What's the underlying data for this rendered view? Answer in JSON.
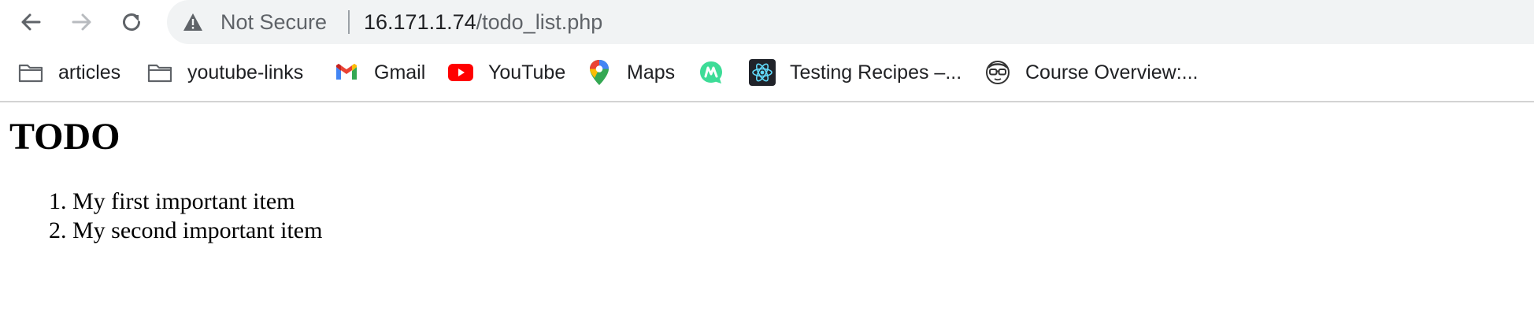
{
  "browser": {
    "security_label": "Not Secure",
    "url_host": "16.171.1.74",
    "url_path": "/todo_list.php",
    "accent": "#f1f3f4"
  },
  "bookmarks": [
    {
      "label": "articles",
      "icon": "folder-icon"
    },
    {
      "label": "youtube-links",
      "icon": "folder-icon"
    },
    {
      "label": "Gmail",
      "icon": "gmail-icon"
    },
    {
      "label": "YouTube",
      "icon": "youtube-icon"
    },
    {
      "label": "Maps",
      "icon": "maps-icon"
    },
    {
      "label": "",
      "icon": "m-logo-icon"
    },
    {
      "label": "Testing Recipes –...",
      "icon": "react-icon"
    },
    {
      "label": "Course Overview:...",
      "icon": "glasses-face-icon"
    }
  ],
  "page": {
    "title": "TODO",
    "items": [
      "My first important item",
      "My second important item"
    ]
  }
}
